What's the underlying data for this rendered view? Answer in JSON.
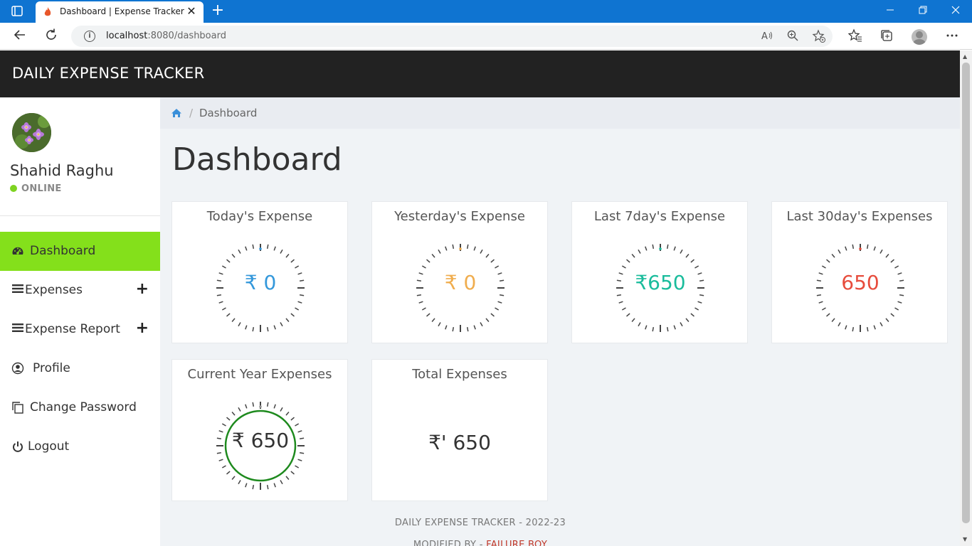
{
  "browser": {
    "tab_title": "Dashboard | Expense Tracker",
    "url_host": "localhost",
    "url_path": ":8080/dashboard",
    "new_tab_glyph": "+",
    "close_glyph": "✕",
    "icons": [
      "tab-actions-icon",
      "flame-favicon-icon",
      "back-icon",
      "refresh-icon",
      "site-info-icon",
      "read-aloud-icon",
      "zoom-icon",
      "add-favorite-icon",
      "favorites-icon",
      "collections-icon",
      "profile-icon",
      "more-icon",
      "minimize-icon",
      "restore-icon",
      "close-window-icon"
    ]
  },
  "header": {
    "brand": "DAILY EXPENSE TRACKER"
  },
  "sidebar": {
    "user_name": "Shahid Raghu",
    "status": "ONLINE",
    "items": [
      {
        "label": "Dashboard",
        "icon": "dashboard-gauge-icon",
        "active": true
      },
      {
        "label": "Expenses",
        "icon": "bars-icon",
        "expandable": true
      },
      {
        "label": "Expense Report",
        "icon": "bars-icon",
        "expandable": true
      },
      {
        "label": "Profile",
        "icon": "user-circle-icon"
      },
      {
        "label": "Change Password",
        "icon": "copy-icon"
      },
      {
        "label": "Logout",
        "icon": "power-icon"
      }
    ],
    "plus_glyph": "+",
    "active_color": "#84e01b"
  },
  "breadcrumb": {
    "separator": "/",
    "current": "Dashboard"
  },
  "main": {
    "title": "Dashboard",
    "cards": [
      {
        "title": "Today's Expense",
        "value": "₹ 0",
        "color": "#3498db"
      },
      {
        "title": "Yesterday's Expense",
        "value": "₹ 0",
        "color": "#f0ad4e"
      },
      {
        "title": "Last 7day's Expense",
        "value": "₹650",
        "color": "#1abc9c"
      },
      {
        "title": "Last 30day's Expenses",
        "value": "650",
        "color": "#e74c3c"
      },
      {
        "title": "Current Year Expenses",
        "value": "₹ 650",
        "color": "#333333",
        "ring_color": "#1e8a1e"
      },
      {
        "title": "Total Expenses",
        "value": "₹' 650",
        "color": "#333333"
      }
    ]
  },
  "footer": {
    "line1": "DAILY EXPENSE TRACKER - 2022-23",
    "line2_prefix": "MODIFIED BY - ",
    "line2_author": "FAILURE BOY"
  }
}
